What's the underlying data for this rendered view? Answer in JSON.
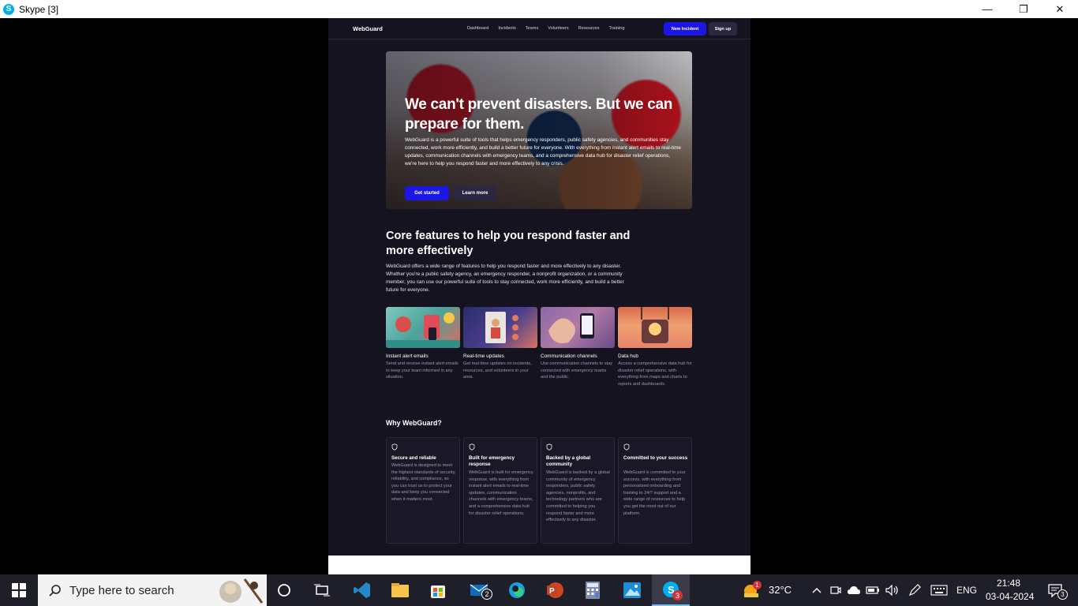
{
  "window": {
    "title": "Skype [3]",
    "app_icon": "S",
    "controls": {
      "minimize": "—",
      "maximize": "❐",
      "close": "✕"
    }
  },
  "site": {
    "logo": "WebGuard",
    "nav_links": [
      "Dashboard",
      "Incidents",
      "Teams",
      "Volunteers",
      "Resources",
      "Training"
    ],
    "new_incident": "New Incident",
    "sign_up": "Sign up"
  },
  "hero": {
    "heading": "We can't prevent disasters. But we can prepare for them.",
    "body": "WebGuard is a powerful suite of tools that helps emergency responders, public safety agencies, and communities stay connected, work more efficiently, and build a better future for everyone. With everything from instant alert emails to real-time updates, communication channels with emergency teams, and a comprehensive data hub for disaster relief operations, we're here to help you respond faster and more effectively to any crisis.",
    "get_started": "Get started",
    "learn_more": "Learn more"
  },
  "core": {
    "title": "Core features to help you respond faster and more effectively",
    "description": "WebGuard offers a wide range of features to help you respond faster and more effectively to any disaster. Whether you're a public safety agency, an emergency responder, a nonprofit organization, or a community member, you can use our powerful suite of tools to stay connected, work more efficiently, and build a better future for everyone.",
    "features": [
      {
        "title": "Instant alert emails",
        "desc": "Send and receive instant alert emails to keep your team informed in any situation."
      },
      {
        "title": "Real-time updates",
        "desc": "Get real-time updates on incidents, resources, and volunteers in your area."
      },
      {
        "title": "Communication channels",
        "desc": "Use communication channels to stay connected with emergency teams and the public."
      },
      {
        "title": "Data hub",
        "desc": "Access a comprehensive data hub for disaster relief operations, with everything from maps and charts to reports and dashboards."
      }
    ]
  },
  "why": {
    "title": "Why WebGuard?",
    "cards": [
      {
        "title": "Secure and reliable",
        "desc": "WebGuard is designed to meet the highest standards of security, reliability, and compliance, so you can trust us to protect your data and keep you connected when it matters most."
      },
      {
        "title": "Built for emergency response",
        "desc": "WebGuard is built for emergency response, with everything from instant alert emails to real-time updates, communication channels with emergency teams, and a comprehensive data hub for disaster relief operations."
      },
      {
        "title": "Backed by a global community",
        "desc": "WebGuard is backed by a global community of emergency responders, public safety agencies, nonprofits, and technology partners who are committed to helping you respond faster and more effectively to any disaster."
      },
      {
        "title": "Committed to your success",
        "desc": "WebGuard is committed to your success, with everything from personalized onboarding and training to 24/7 support and a wide range of resources to help you get the most out of our platform."
      }
    ]
  },
  "taskbar": {
    "search_placeholder": "Type here to search",
    "mail_badge": "2",
    "skype_badge": "3",
    "weather_badge": "1",
    "temperature": "32°C",
    "language": "ENG",
    "time": "21:48",
    "date": "03-04-2024",
    "notifications": "3"
  },
  "colors": {
    "page_bg": "#15131f",
    "accent_blue": "#1a16e6",
    "secondary_btn": "#2a2740",
    "taskbar_bg": "#1f1f2a"
  }
}
